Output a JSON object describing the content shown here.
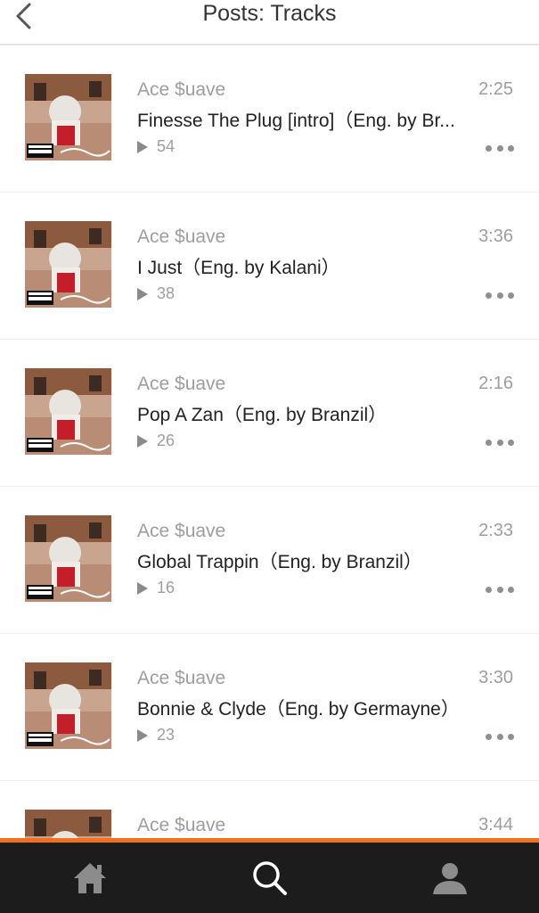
{
  "header": {
    "title": "Posts: Tracks",
    "back_icon": "chevron-left-icon"
  },
  "tracks": [
    {
      "artist": "Ace $uave",
      "title": "Finesse The Plug [intro]（Eng. by Br...",
      "duration": "2:25",
      "plays": "54"
    },
    {
      "artist": "Ace $uave",
      "title": "I Just（Eng. by Kalani）",
      "duration": "3:36",
      "plays": "38"
    },
    {
      "artist": "Ace $uave",
      "title": "Pop A Zan（Eng. by Branzil）",
      "duration": "2:16",
      "plays": "26"
    },
    {
      "artist": "Ace $uave",
      "title": "Global Trappin（Eng. by Branzil）",
      "duration": "2:33",
      "plays": "16"
    },
    {
      "artist": "Ace $uave",
      "title": "Bonnie & Clyde（Eng. by Germayne）",
      "duration": "3:30",
      "plays": "23"
    },
    {
      "artist": "Ace $uave",
      "title": "",
      "duration": "3:44",
      "plays": ""
    }
  ],
  "tabbar": {
    "items": [
      "home-icon",
      "search-icon",
      "profile-icon"
    ],
    "accent_color": "#f26f21",
    "background_color": "#1c1c1c"
  }
}
